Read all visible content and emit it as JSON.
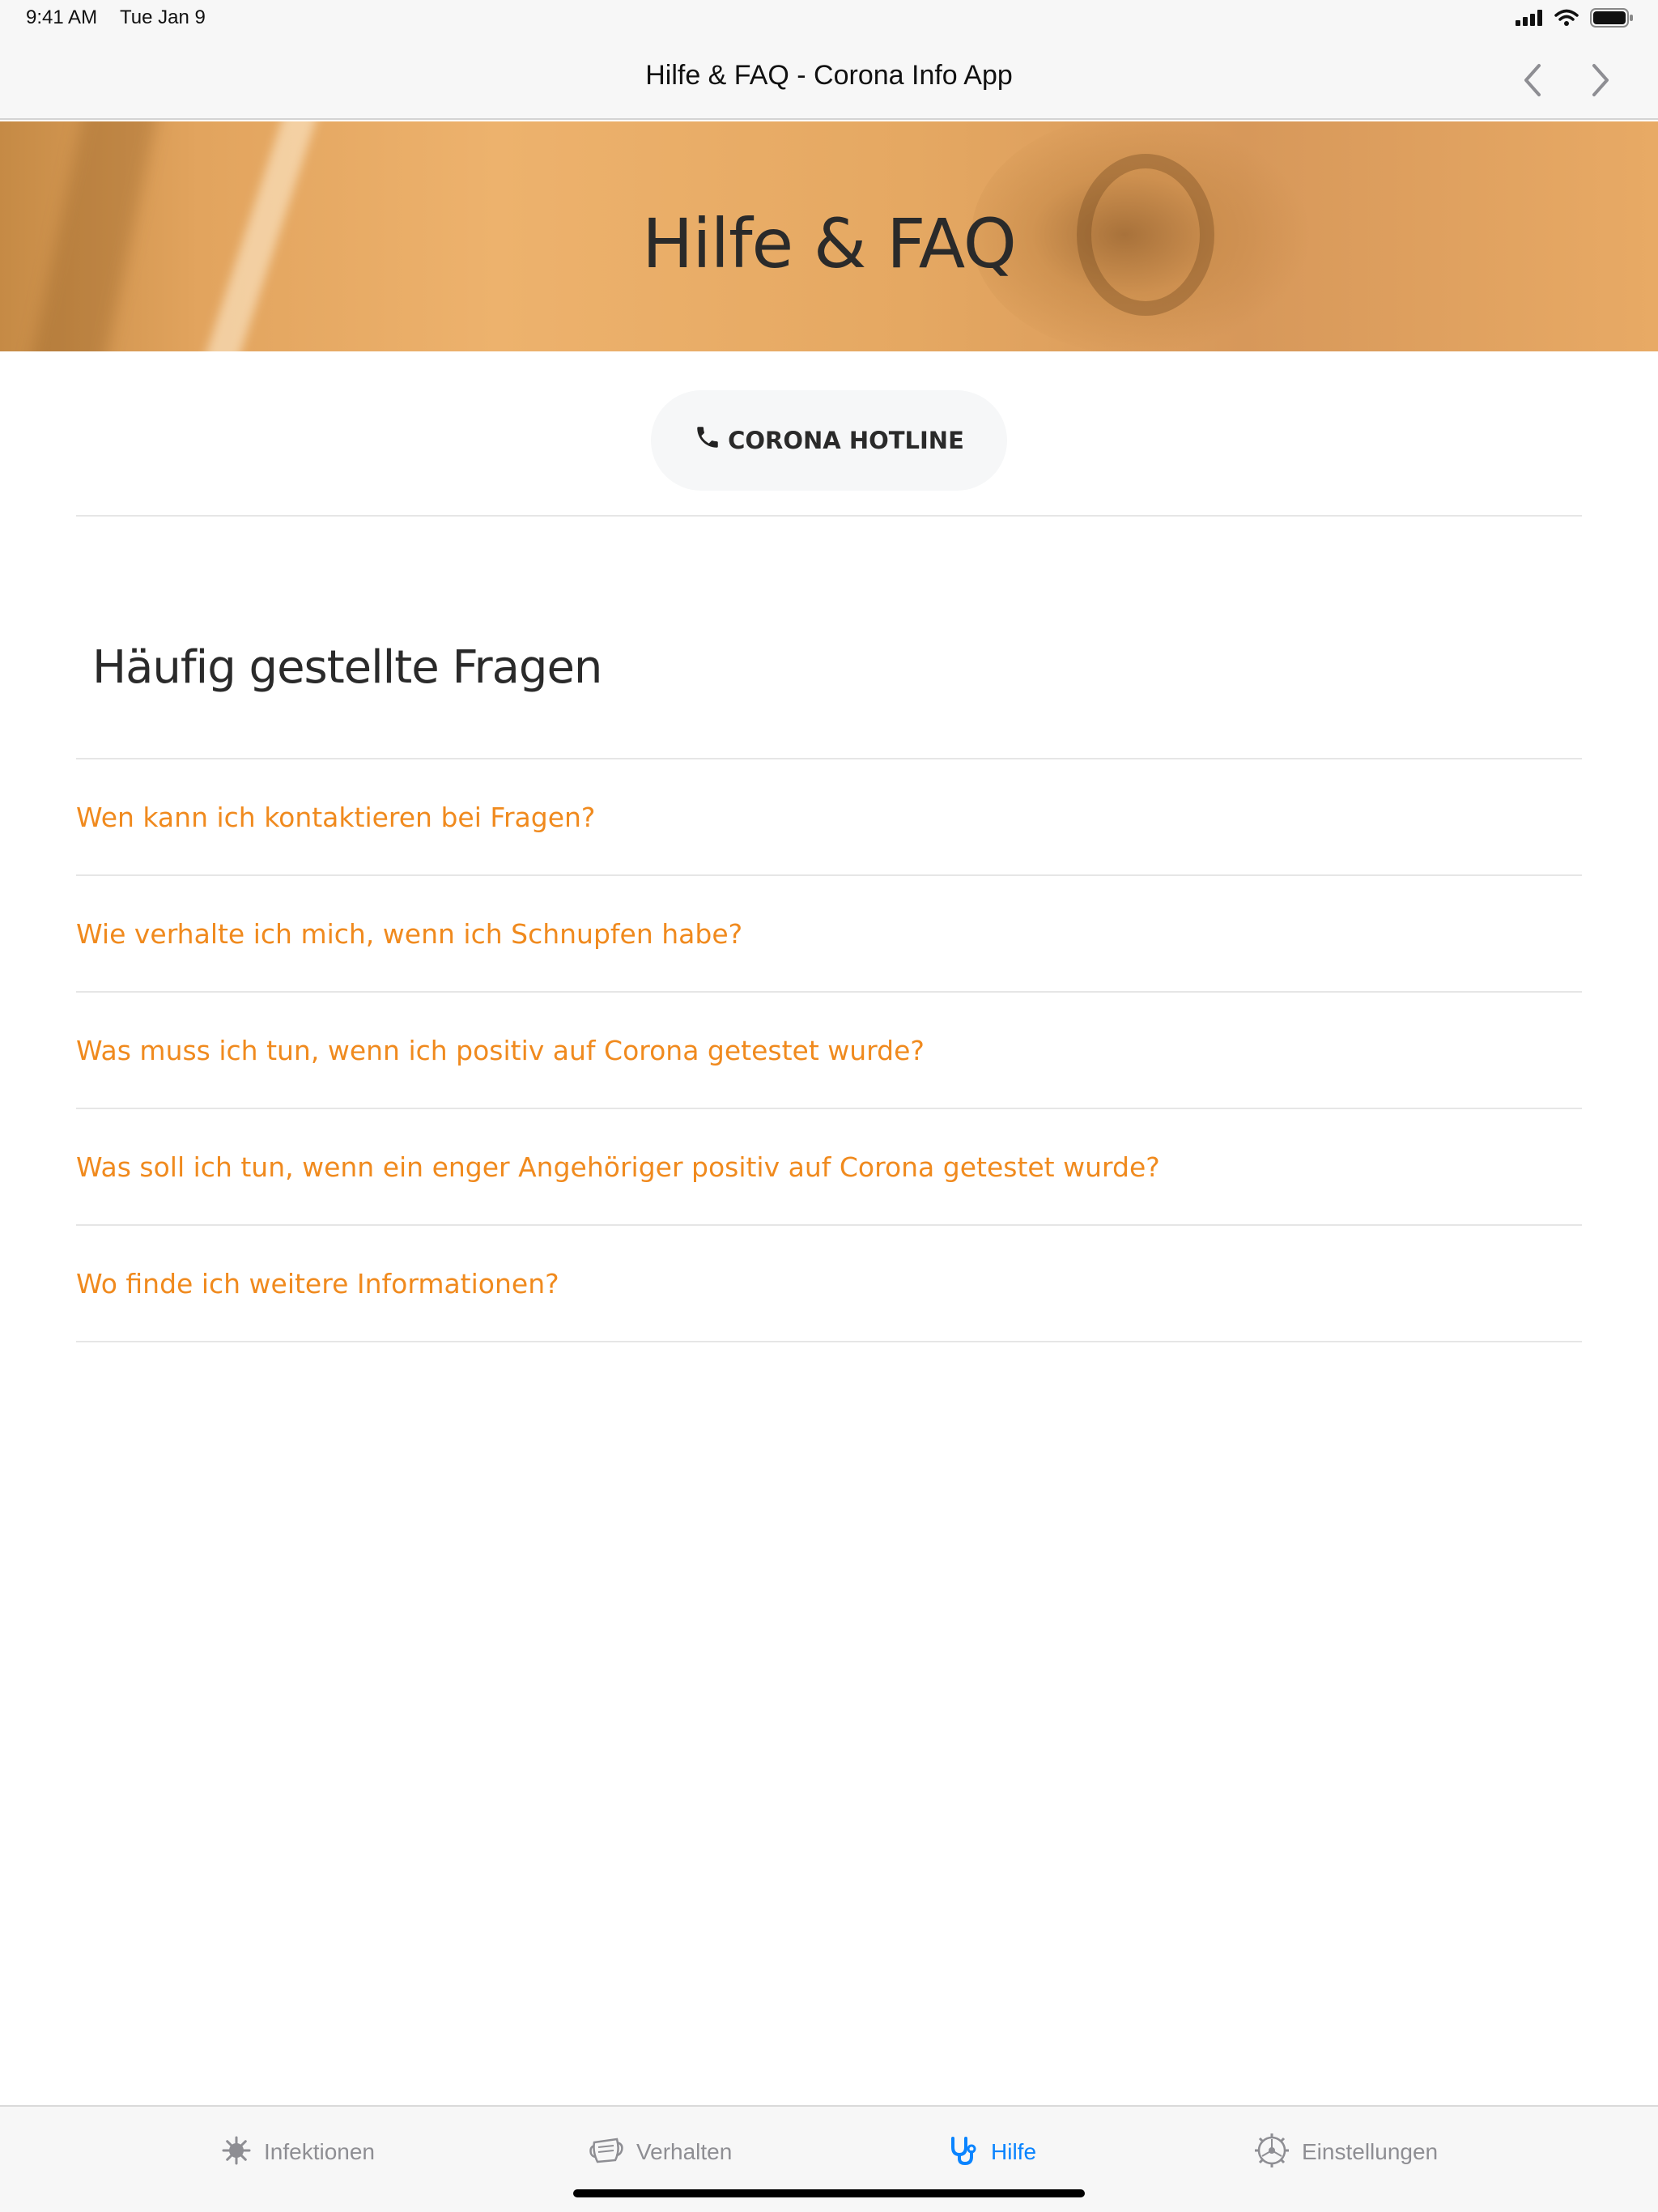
{
  "status_bar": {
    "time": "9:41 AM",
    "date": "Tue Jan 9"
  },
  "nav": {
    "title": "Hilfe & FAQ - Corona Info App"
  },
  "hero": {
    "title": "Hilfe & FAQ"
  },
  "hotline": {
    "label": "CORONA HOTLINE",
    "icon": "phone-icon"
  },
  "faq": {
    "heading": "Häufig gestellte Fragen",
    "items": [
      {
        "question": "Wen kann ich kontaktieren bei Fragen?"
      },
      {
        "question": "Wie verhalte ich mich, wenn ich Schnupfen habe?"
      },
      {
        "question": "Was muss ich tun, wenn ich positiv auf Corona getestet wurde?"
      },
      {
        "question": "Was soll ich tun, wenn ein enger Angehöriger positiv auf Corona getestet wurde?"
      },
      {
        "question": "Wo finde ich weitere Informationen?"
      }
    ]
  },
  "tab_bar": {
    "tabs": [
      {
        "label": "Infektionen",
        "icon": "virus-icon",
        "active": false
      },
      {
        "label": "Verhalten",
        "icon": "mask-icon",
        "active": false
      },
      {
        "label": "Hilfe",
        "icon": "stethoscope-icon",
        "active": true
      },
      {
        "label": "Einstellungen",
        "icon": "gear-icon",
        "active": false
      }
    ]
  },
  "colors": {
    "accent": "#f08a1e",
    "tab_active": "#0a84ff",
    "tab_inactive": "#8e8e93",
    "hero": "#e5a862"
  }
}
